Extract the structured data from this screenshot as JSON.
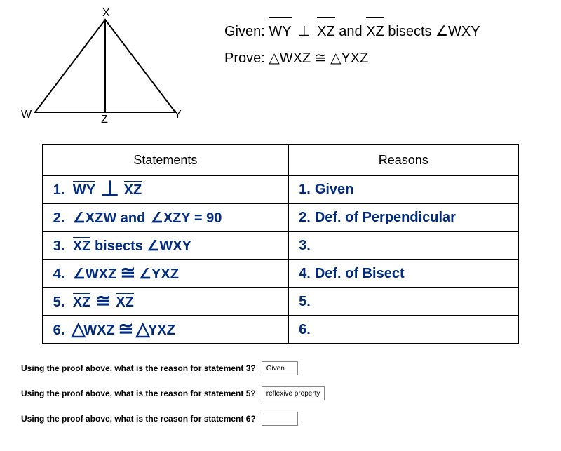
{
  "triangle": {
    "label_top": "X",
    "label_left": "W",
    "label_mid": "Z",
    "label_right": "Y"
  },
  "givenProve": {
    "given_prefix": "Given: ",
    "given_seg1": "WY",
    "given_perp": "⊥",
    "given_seg2": "XZ",
    "given_mid": " and ",
    "given_seg3": "XZ",
    "given_suffix": "  bisects  ∠WXY",
    "prove_prefix": "Prove: ",
    "prove_t1": "WXZ",
    "prove_cong": " ≅ ",
    "prove_t2": "YXZ"
  },
  "tableHeaders": {
    "statements": "Statements",
    "reasons": "Reasons"
  },
  "rows": [
    {
      "s_num": "1.",
      "s_parts": {
        "a": "WY",
        "b": "XZ"
      },
      "r_num": "1.",
      "r_text": "Given"
    },
    {
      "s_num": "2.",
      "s_text_a": "∠XZW and",
      "s_text_b": "∠XZY = 90",
      "r_num": "2.",
      "r_text": "Def. of Perpendicular"
    },
    {
      "s_num": "3.",
      "s_seg": "XZ",
      "s_text_after": " bisects ∠WXY",
      "r_num": "3.",
      "r_text": ""
    },
    {
      "s_num": "4.",
      "s_text_a": "∠WXZ",
      "s_text_b": "∠YXZ",
      "r_num": "4.",
      "r_text": "Def. of Bisect"
    },
    {
      "s_num": "5.",
      "s_seg1": "XZ",
      "s_seg2": "XZ",
      "r_num": "5.",
      "r_text": ""
    },
    {
      "s_num": "6.",
      "s_t1": "WXZ",
      "s_t2": "YXZ",
      "r_num": "6.",
      "r_text": ""
    }
  ],
  "questions": {
    "q1": "Using the proof above, what is the reason for statement 3?",
    "a1": "Given",
    "q2": "Using the proof above, what is the reason for statement 5?",
    "a2": "reflexive property",
    "q3": "Using the proof above, what is the reason for statement 6?",
    "a3": ""
  }
}
